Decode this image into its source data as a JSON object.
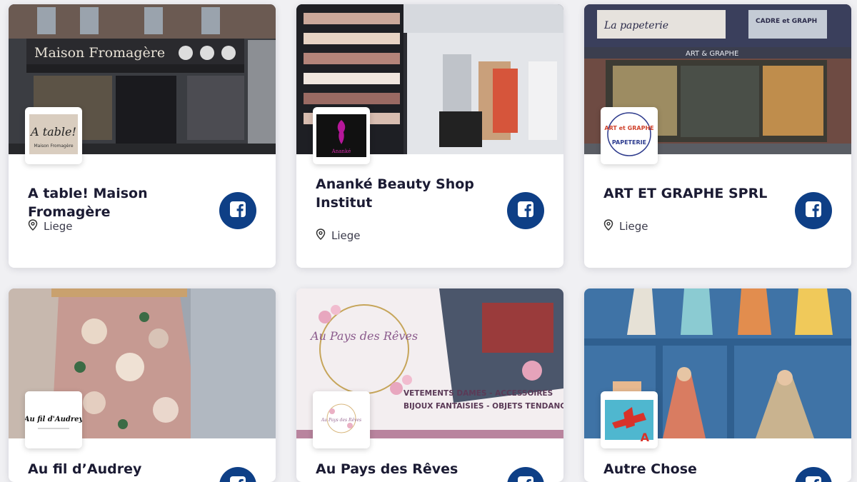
{
  "shops": [
    {
      "name": "A table! Maison Fromagère",
      "location": "Liege",
      "logo_text": "A table!",
      "logo_subtext": "Maison Fromagère",
      "social": "facebook-icon"
    },
    {
      "name": "Ananké Beauty Shop Institut",
      "location": "Liege",
      "logo_text": "Ananké",
      "social": "facebook-icon"
    },
    {
      "name": "ART ET GRAPHE SPRL",
      "location": "Liege",
      "logo_text": "ART et GRAPHE",
      "logo_subtext": "PAPETERIE",
      "social": "facebook-icon"
    },
    {
      "name": "Au fil d’Audrey",
      "location": "",
      "logo_text": "Au fil d'Audrey",
      "social": "facebook-icon"
    },
    {
      "name": "Au Pays des Rêves",
      "location": "",
      "logo_text": "Au Pays des Rêves",
      "social": "facebook-icon"
    },
    {
      "name": "Autre Chose",
      "location": "",
      "logo_text": "A",
      "social": "facebook-icon"
    }
  ],
  "photo_text": {
    "shop0_sign": "Maison Fromagère",
    "shop2_sign": "ART & GRAPHE",
    "shop2_sign_top": "La papeterie",
    "shop2_sign_right": "CADRE et GRAPH",
    "shop4_script": "Au Pays des Rêves",
    "shop4_line1": "VETEMENTS DAMES - ACCESSOIRES",
    "shop4_line2": "BIJOUX FANTAISIES - OBJETS TENDANCES"
  },
  "colors": {
    "facebook_button": "#0e3f86",
    "title": "#1b1b33",
    "background": "#f0f0f3"
  }
}
